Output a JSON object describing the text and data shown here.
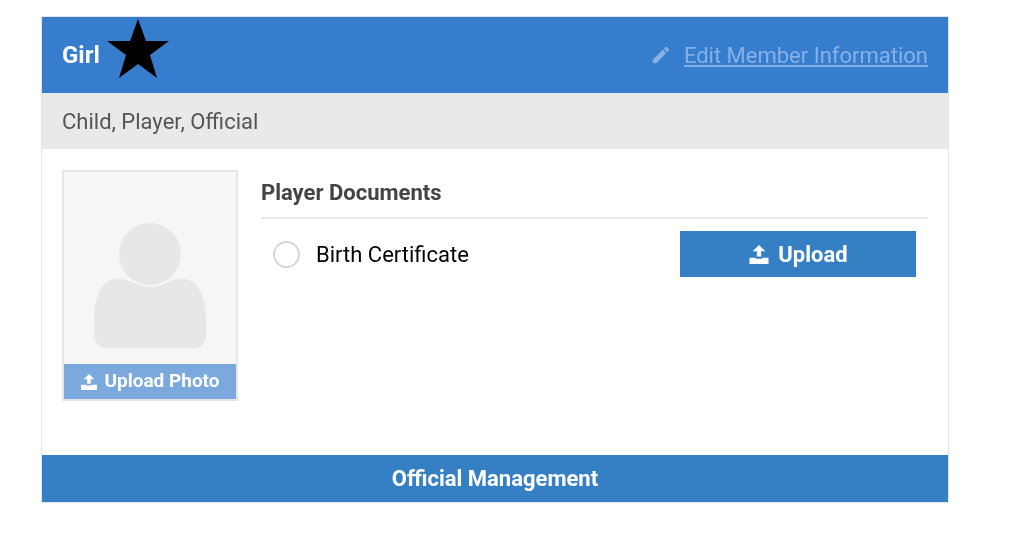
{
  "header": {
    "name": "Girl",
    "edit_link": "Edit Member Information"
  },
  "roles": "Child, Player, Official",
  "photo": {
    "upload_label": "Upload Photo"
  },
  "documents": {
    "title": "Player Documents",
    "items": [
      {
        "label": "Birth Certificate",
        "checked": false,
        "button": "Upload"
      }
    ]
  },
  "footer": "Official Management"
}
